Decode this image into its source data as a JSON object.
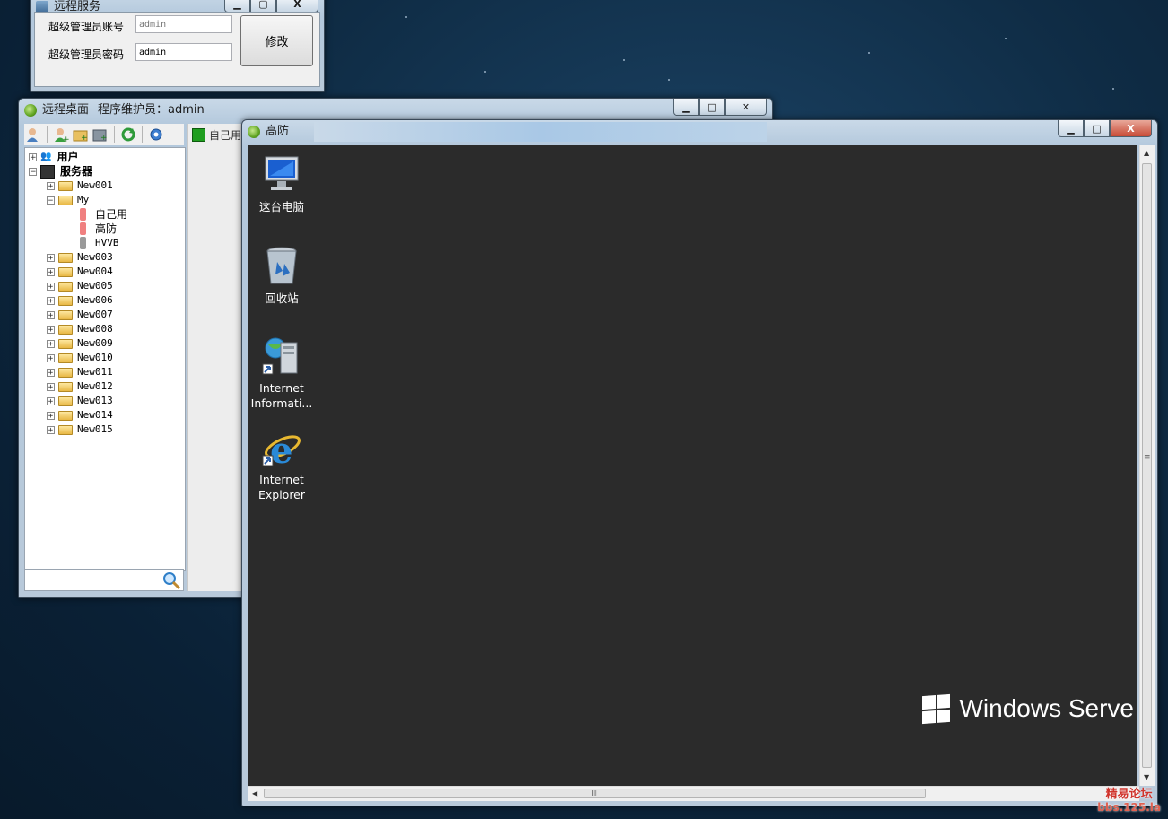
{
  "admin_window": {
    "title": "远程服务",
    "account_label": "超级管理员账号",
    "account_value": "admin",
    "password_label": "超级管理员密码",
    "password_value": "admin",
    "modify_button": "修改",
    "caption": {
      "min": "▁",
      "max": "▢",
      "close": "X"
    }
  },
  "desktop_window": {
    "title": "远程桌面",
    "operator_label": "程序维护员：admin",
    "caption": {
      "min": "▁",
      "max": "□",
      "close": "✕"
    },
    "toolbar": [
      "user-icon",
      "add-user-icon",
      "add-folder-icon",
      "add-server-icon",
      "refresh-icon",
      "settings-icon"
    ],
    "tab_label": "自己用",
    "tree": {
      "users": "用户",
      "servers": "服务器",
      "groups": [
        "New001",
        "My",
        "New003",
        "New004",
        "New005",
        "New006",
        "New007",
        "New008",
        "New009",
        "New010",
        "New011",
        "New012",
        "New013",
        "New014",
        "New015"
      ],
      "my_children": [
        "自己用",
        "高防",
        "HVVB"
      ]
    }
  },
  "viewer_window": {
    "title": "高防",
    "caption": {
      "min": "▁",
      "max": "□",
      "close": "X"
    },
    "icons": [
      {
        "line1": "这台电脑",
        "line2": ""
      },
      {
        "line1": "回收站",
        "line2": ""
      },
      {
        "line1": "Internet",
        "line2": "Informati..."
      },
      {
        "line1": "Internet",
        "line2": "Explorer"
      }
    ],
    "os_brand": "Windows Serve",
    "hscroll_grip": "III",
    "vscroll_grip": "≡"
  },
  "watermark": {
    "line1": "精易论坛",
    "line2": "bbs.125.la"
  },
  "colors": {
    "desktop_bg": "#2b2b2b",
    "wallpaper": "#0f2c45",
    "close_button": "#c74b36"
  }
}
